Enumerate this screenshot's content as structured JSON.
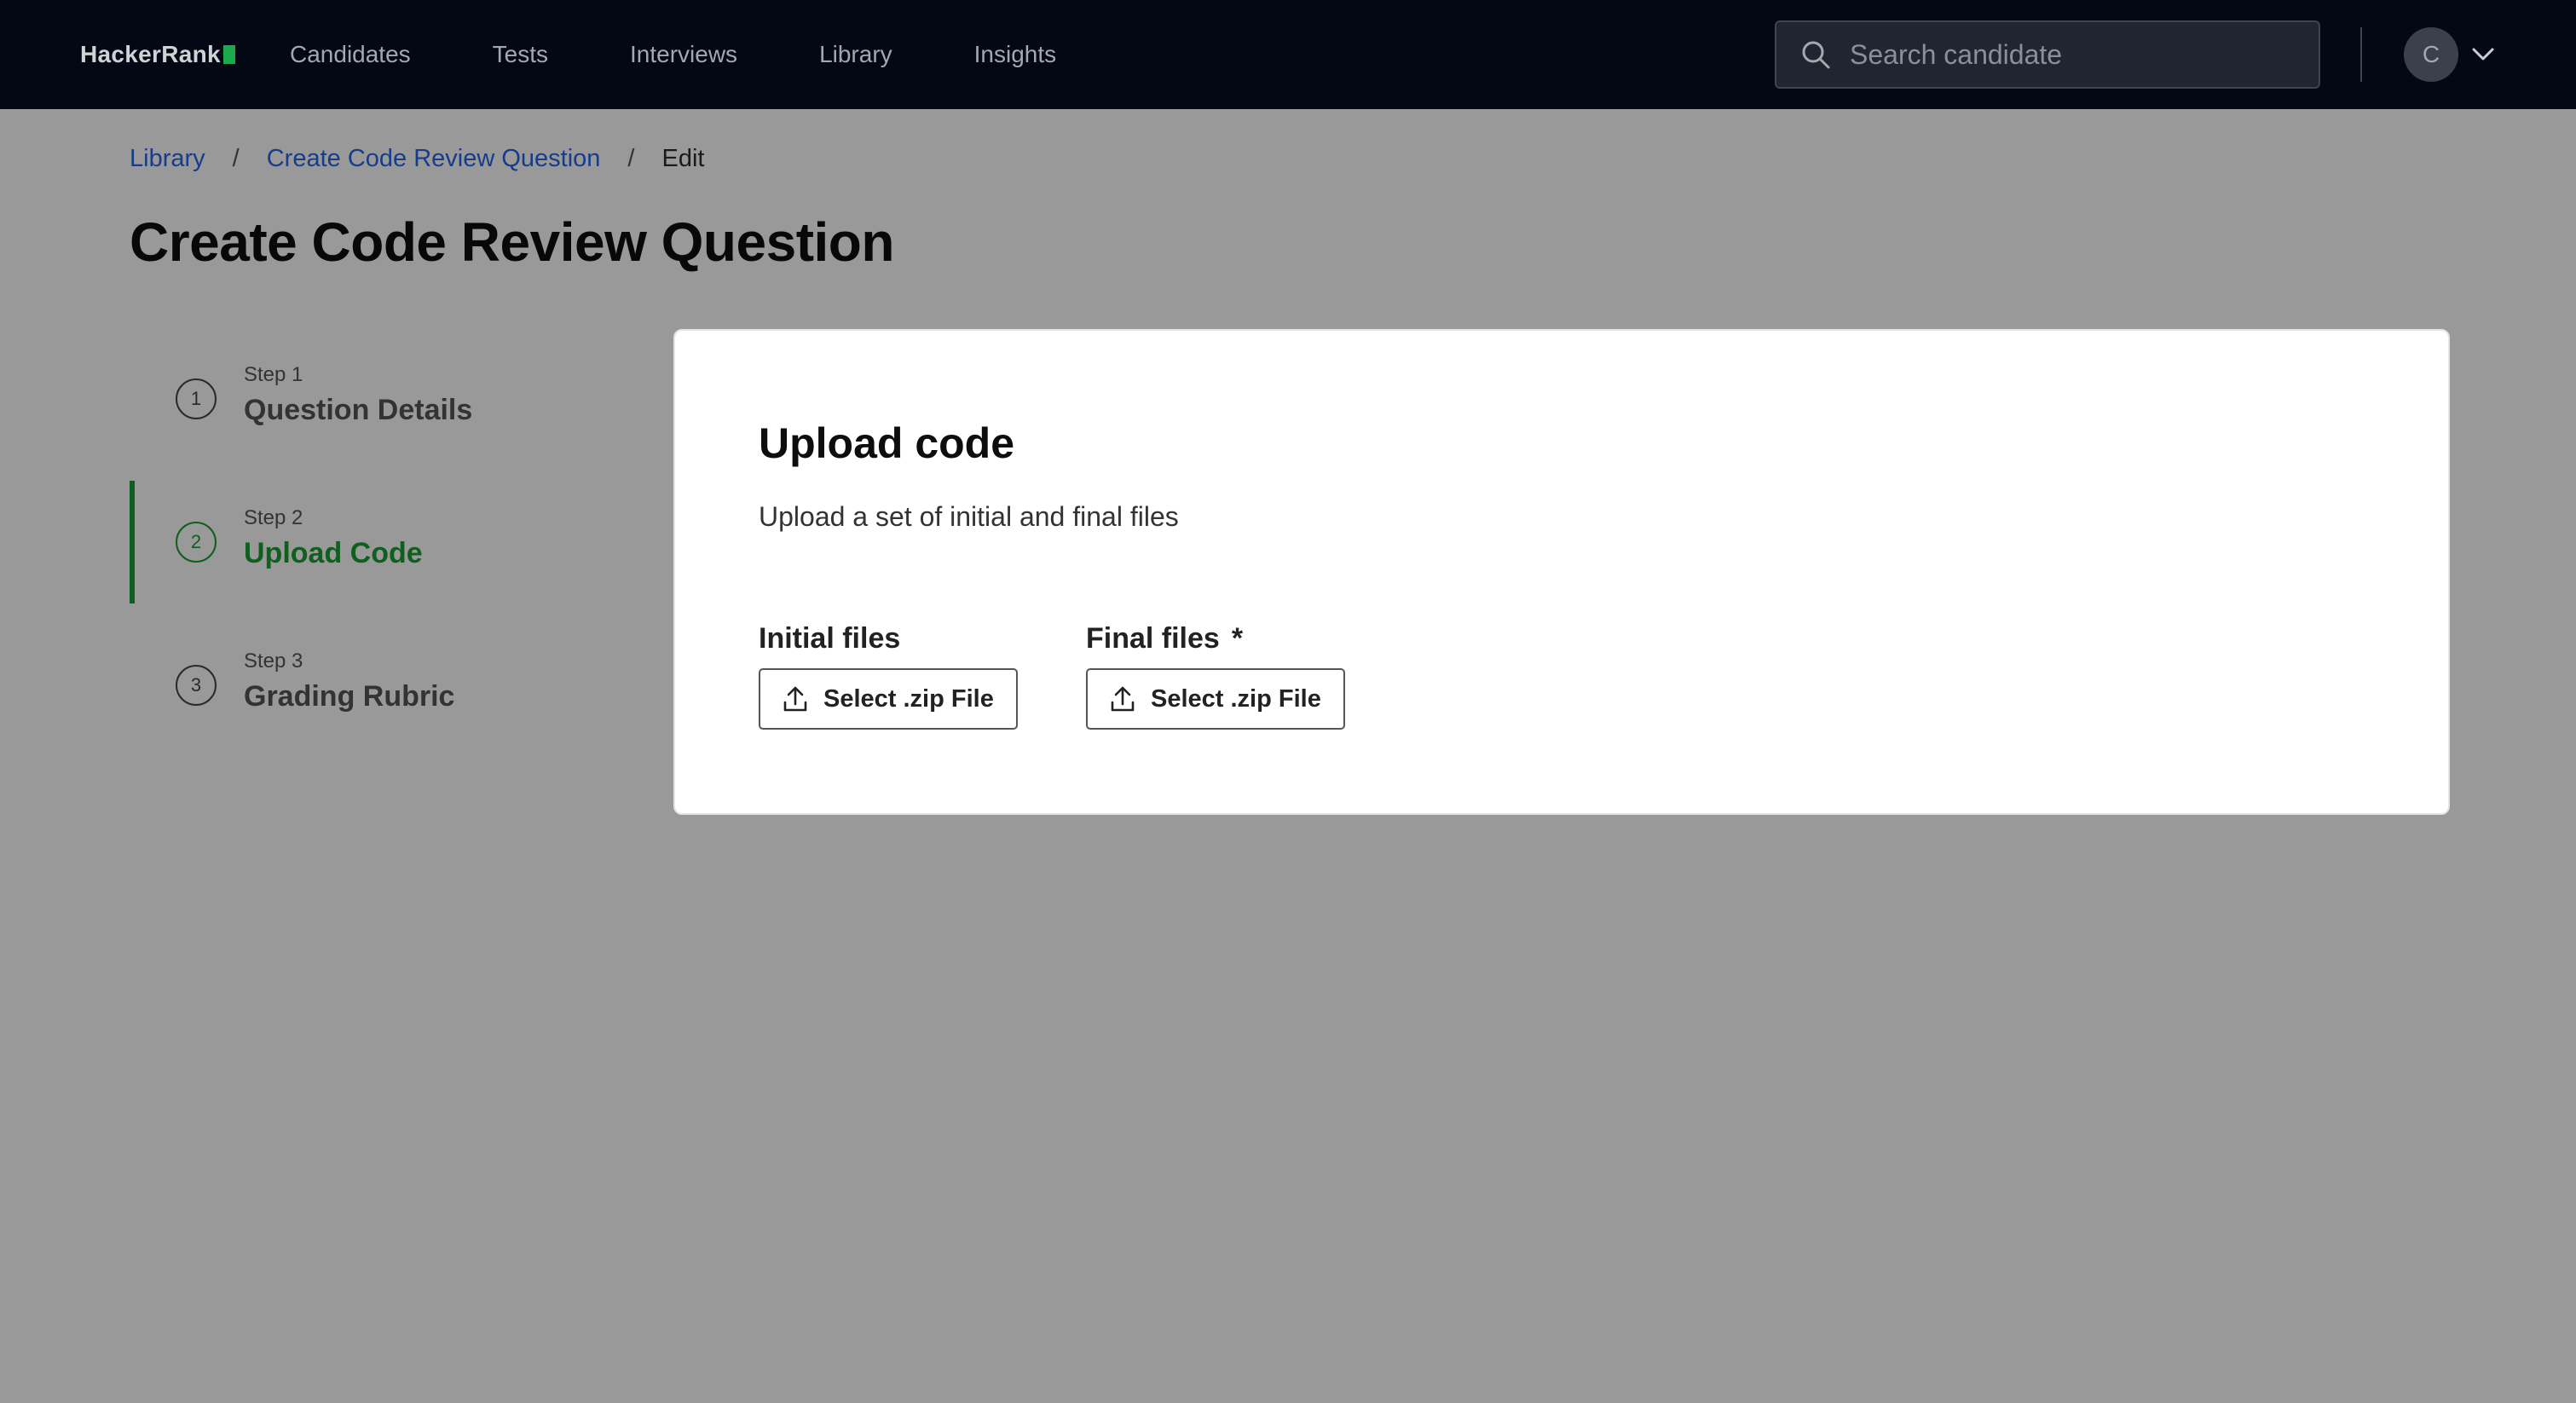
{
  "app": {
    "logo_text": "HackerRank"
  },
  "nav": {
    "items": [
      {
        "label": "Candidates"
      },
      {
        "label": "Tests"
      },
      {
        "label": "Interviews"
      },
      {
        "label": "Library"
      },
      {
        "label": "Insights"
      }
    ],
    "search": {
      "placeholder": "Search candidate",
      "value": ""
    },
    "avatar_initial": "C"
  },
  "breadcrumb": {
    "items": [
      {
        "label": "Library"
      },
      {
        "label": "Create Code Review Question"
      }
    ],
    "current": "Edit",
    "separator": "/"
  },
  "page": {
    "title": "Create Code Review Question"
  },
  "steps": [
    {
      "number": "1",
      "label": "Step 1",
      "title": "Question Details",
      "active": false
    },
    {
      "number": "2",
      "label": "Step 2",
      "title": "Upload Code",
      "active": true
    },
    {
      "number": "3",
      "label": "Step 3",
      "title": "Grading Rubric",
      "active": false
    }
  ],
  "card": {
    "title": "Upload code",
    "subtitle": "Upload a set of initial and final files",
    "initial_files": {
      "label": "Initial files",
      "button_label": "Select .zip File"
    },
    "final_files": {
      "label": "Final files",
      "required_mark": "*",
      "button_label": "Select .zip File"
    }
  },
  "colors": {
    "nav_bg": "#030914",
    "page_bg": "#999999",
    "accent_green": "#0f5f1e",
    "link_blue": "#163c8a",
    "logo_green": "#1ba94c"
  }
}
